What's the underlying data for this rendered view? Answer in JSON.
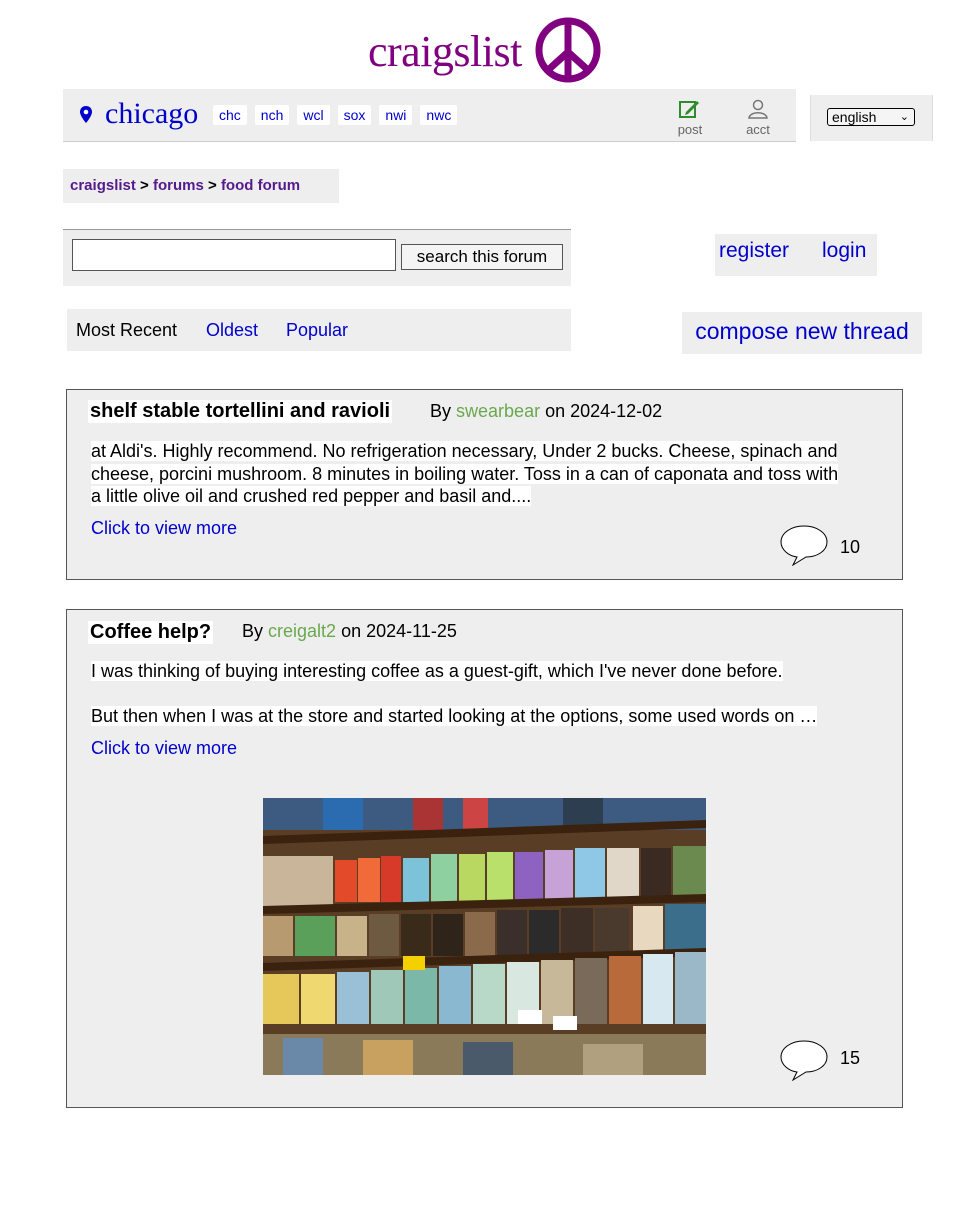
{
  "site": {
    "logo_text": "craigslist",
    "city": "chicago",
    "areas": [
      "chc",
      "nch",
      "wcl",
      "sox",
      "nwi",
      "nwc"
    ],
    "post_label": "post",
    "acct_label": "acct",
    "language": "english"
  },
  "breadcrumb": {
    "root": "craigslist",
    "sep1": ">",
    "forums": "forums",
    "sep2": ">",
    "current": "food forum"
  },
  "search": {
    "value": "",
    "button": "search this forum"
  },
  "account": {
    "register": "register",
    "login": "login"
  },
  "sort": {
    "active": "Most Recent",
    "options": [
      "Oldest",
      "Popular"
    ]
  },
  "compose": "compose new thread",
  "threads": [
    {
      "title": "shelf stable tortellini and ravioli",
      "by": "By",
      "author": "swearbear",
      "on": "on 2024-12-02",
      "body": [
        "at Aldi's. Highly recommend. No refrigeration necessary, Under 2 bucks. Cheese, spinach and",
        "cheese, porcini mushroom. 8 minutes in boiling water. Toss in a can of caponata and toss with",
        "a little olive oil and crushed red pepper and basil and...."
      ],
      "more": "Click to view more",
      "comments": "10"
    },
    {
      "title": "Coffee help?",
      "by": "By",
      "author": "creigalt2",
      "on": "on 2024-11-25",
      "body": [
        "I was thinking of buying interesting coffee as a guest-gift, which I've never done before.",
        "But then when I was at the store and started looking at the options, some used words on …"
      ],
      "more": "Click to view more",
      "comments": "15",
      "image": "coffee-shelf-photo"
    }
  ],
  "colors": {
    "brand": "#800080",
    "link": "#0000cc",
    "author": "#6aa84f",
    "panel": "#eeeeee"
  }
}
